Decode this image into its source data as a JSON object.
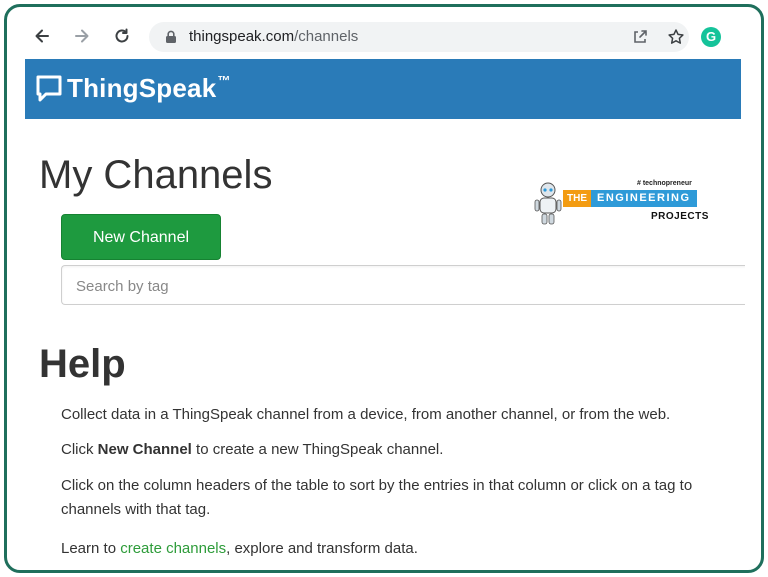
{
  "browser": {
    "url_host": "thingspeak.com",
    "url_path": "/channels",
    "extension_icon": "G"
  },
  "header": {
    "logo_text": "ThingSpeak",
    "logo_tm": "™"
  },
  "main": {
    "title": "My Channels",
    "new_channel_label": "New Channel",
    "search_placeholder": "Search by tag"
  },
  "watermark": {
    "tag": "# technopreneur",
    "the": "THE",
    "engineering": "ENGINEERING",
    "projects": "PROJECTS"
  },
  "help": {
    "title": "Help",
    "line1": "Collect data in a ThingSpeak channel from a device, from another channel, or from the web.",
    "line2_prefix": "Click ",
    "line2_bold": "New Channel",
    "line2_suffix": " to create a new ThingSpeak channel.",
    "line3a": "Click on the column headers of the table to sort by the entries in that column or click on a tag to",
    "line3b": "channels with that tag.",
    "line4_prefix": "Learn to ",
    "line4_link": "create channels",
    "line4_suffix": ", explore and transform data."
  },
  "colors": {
    "header_bg": "#2a7bb8",
    "button_bg": "#1e9a3f",
    "link": "#2e9c3a",
    "frame_border": "#1f6f5c"
  }
}
